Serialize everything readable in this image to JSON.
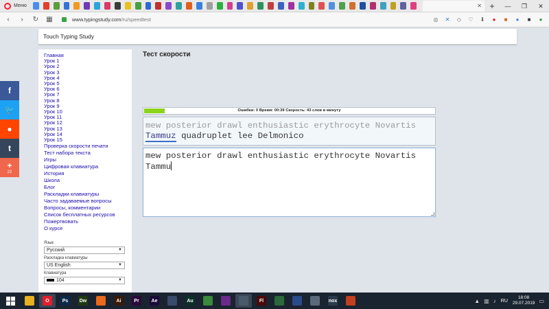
{
  "browser": {
    "menu_label": "Меню",
    "active_tab_title": "",
    "new_tab": "+",
    "window_controls": {
      "minimize": "—",
      "maximize": "❐",
      "close": "✕"
    },
    "url": {
      "host": "www.typingstudy.com",
      "path": "/ru/speedtest"
    },
    "mini_tab_colors": [
      "#4a8cf0",
      "#e0402c",
      "#5a9e3a",
      "#3a6fd8",
      "#f09a20",
      "#6f3ab5",
      "#2aa5d8",
      "#d83a6a",
      "#3a3a3a",
      "#e8c020",
      "#4aa040",
      "#2a6ad0",
      "#c03030",
      "#8a4ad0",
      "#30a0a0",
      "#e06020",
      "#3a80e0",
      "#a0a0a0",
      "#2ab040",
      "#d04090",
      "#5050d0",
      "#e0a030",
      "#309060",
      "#c04040",
      "#4060c0",
      "#a030a0",
      "#30b0d0",
      "#808020",
      "#e05050",
      "#5090e0",
      "#50a050",
      "#d07030",
      "#2050a0",
      "#b03070",
      "#40a0c0",
      "#c0a020",
      "#6060a0",
      "#e04080"
    ]
  },
  "social": {
    "share_count": "22"
  },
  "site": {
    "title": "Touch Typing Study",
    "heading": "Тест скорости",
    "nav": [
      "Главная",
      "Урок 1",
      "Урок 2",
      "Урок 3",
      "Урок 4",
      "Урок 5",
      "Урок 6",
      "Урок 7",
      "Урок 8",
      "Урок 9",
      "Урок 10",
      "Урок 11",
      "Урок 12",
      "Урок 13",
      "Урок 14",
      "Урок 15",
      "Проверка скорости печати",
      "Тест набора текста",
      "Игры",
      "Цифровая клавиатура",
      "История",
      "Школа",
      "Блог",
      "Раскладки клавиатуры",
      "Часто задаваемые вопросы",
      "Вопросы, комментарии",
      "Список бесплатных ресурсов",
      "Пожертвовать",
      "О курсе"
    ],
    "settings": {
      "language_label": "Язык",
      "language_value": "Русский",
      "layout_label": "Раскладка клавиатуры",
      "layout_value": "US English",
      "keyboard_label": "Клавиатура",
      "keyboard_value": "104"
    }
  },
  "test": {
    "stats": "Ошибки: 0 Время: 00:39 Скорость: 43 слов в минуту",
    "progress_fraction": 0.07,
    "typed_words": "mew posterior drawl enthusiastic erythrocyte Novartis",
    "current_word": "Tammuz",
    "pending_words": "quadruplet lee Delmonico",
    "input_value": "mew posterior drawl enthusiastic erythrocyte Novartis Tammu"
  },
  "taskbar": {
    "apps": [
      {
        "name": "chrome",
        "label": "",
        "color": "#e8b020"
      },
      {
        "name": "opera",
        "label": "O",
        "color": "#e0202c",
        "active": true
      },
      {
        "name": "photoshop",
        "label": "Ps",
        "color": "#0a2a48"
      },
      {
        "name": "dreamweaver",
        "label": "Dw",
        "color": "#1f3a10"
      },
      {
        "name": "firefox",
        "label": "",
        "color": "#e86a1a"
      },
      {
        "name": "illustrator",
        "label": "Ai",
        "color": "#3a1a08"
      },
      {
        "name": "premiere",
        "label": "Pr",
        "color": "#2a0a3a"
      },
      {
        "name": "after-effects",
        "label": "Ae",
        "color": "#1a0a3a"
      },
      {
        "name": "app-9",
        "label": "",
        "color": "#3a4a6a"
      },
      {
        "name": "audition",
        "label": "Au",
        "color": "#0a3028"
      },
      {
        "name": "app-11",
        "label": "",
        "color": "#3a8a3a"
      },
      {
        "name": "app-12",
        "label": "",
        "color": "#6a2a8a"
      },
      {
        "name": "app-13",
        "label": "",
        "color": "#4a5a6a",
        "active": true
      },
      {
        "name": "flash",
        "label": "Fl",
        "color": "#4a0a0a"
      },
      {
        "name": "app-15",
        "label": "",
        "color": "#2a6a3a"
      },
      {
        "name": "app-16",
        "label": "",
        "color": "#2a4a8a"
      },
      {
        "name": "app-17",
        "label": "",
        "color": "#5a6a7a"
      },
      {
        "name": "nox",
        "label": "nox",
        "color": "#2a3a4a"
      },
      {
        "name": "app-19",
        "label": "",
        "color": "#c04020"
      }
    ],
    "language": "RU",
    "time": "18:08",
    "date": "29.07.2019"
  }
}
